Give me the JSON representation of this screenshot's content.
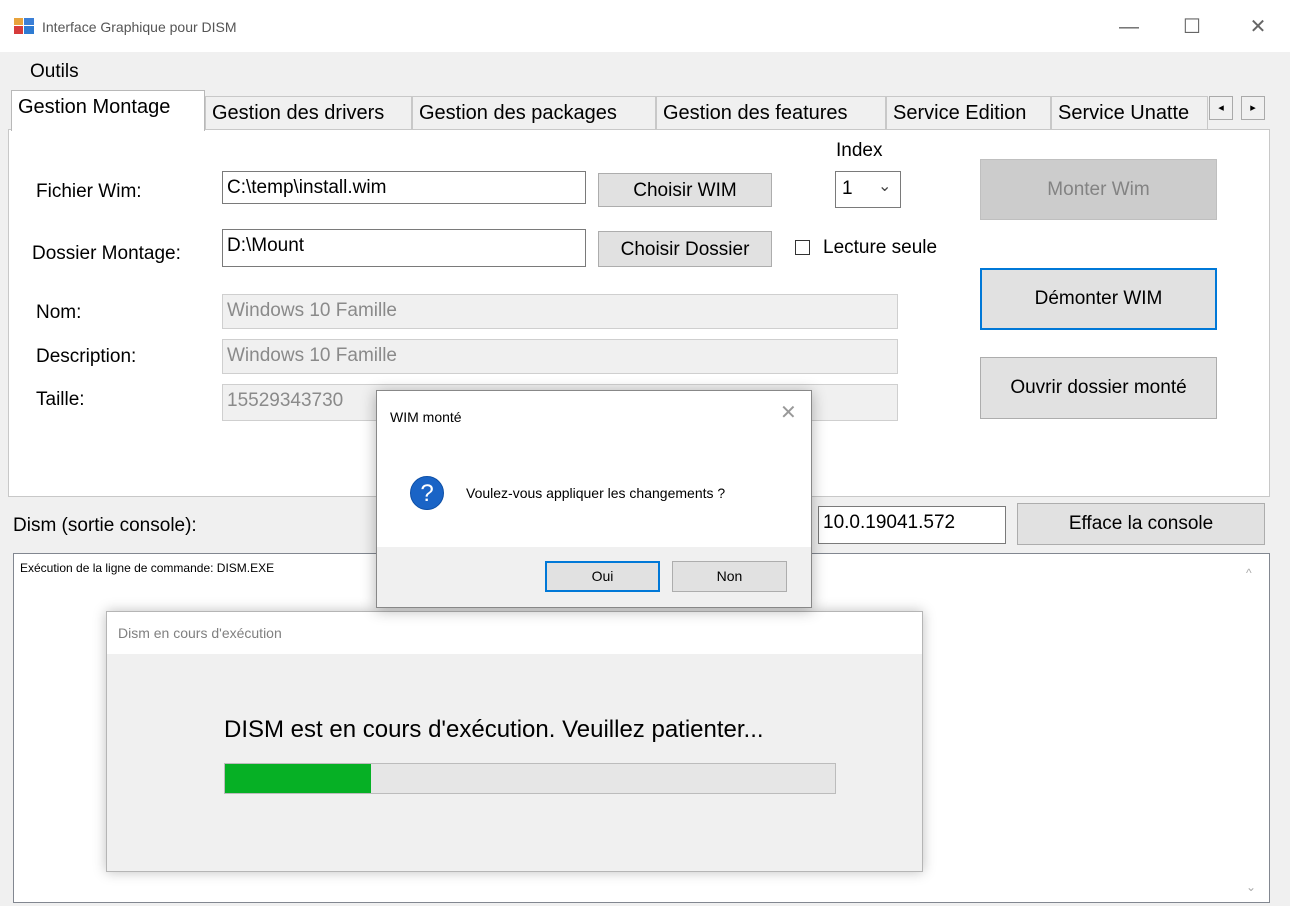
{
  "window": {
    "title": "Interface Graphique pour DISM",
    "minimize": "—",
    "maximize": "☐",
    "close": "✕"
  },
  "menu": {
    "outils": "Outils"
  },
  "tabs": [
    {
      "label": "Gestion Montage"
    },
    {
      "label": "Gestion des drivers"
    },
    {
      "label": "Gestion des packages"
    },
    {
      "label": "Gestion des features"
    },
    {
      "label": "Service Edition"
    },
    {
      "label": "Service Unatte"
    }
  ],
  "tab_scroll": {
    "left": "◂",
    "right": "▸"
  },
  "mount": {
    "fichier_label": "Fichier Wim:",
    "fichier_value": "C:\\temp\\install.wim",
    "choisir_wim": "Choisir WIM",
    "index_label": "Index",
    "index_value": "1",
    "index_chevron": "⌄",
    "monter_wim": "Monter Wim",
    "dossier_label": "Dossier Montage:",
    "dossier_value": "D:\\Mount",
    "choisir_dossier": "Choisir Dossier",
    "lecture_seule": "Lecture seule",
    "lecture_seule_checked": false,
    "demonter_wim": "Démonter WIM",
    "ouvrir_dossier": "Ouvrir dossier monté",
    "nom_label": "Nom:",
    "nom_value": "Windows 10 Famille",
    "description_label": "Description:",
    "description_value": "Windows 10 Famille",
    "taille_label": "Taille:",
    "taille_value": "15529343730"
  },
  "console": {
    "label": "Dism (sortie console):",
    "version": "10.0.19041.572",
    "clear_button": "Efface la console",
    "output": "Exécution de la ligne de commande: DISM.EXE"
  },
  "progress": {
    "title": "Dism en cours d'exécution",
    "message": "DISM est en cours d'exécution. Veuillez patienter...",
    "fraction": 0.24,
    "color": "#06b025"
  },
  "messagebox": {
    "title": "WIM monté",
    "close": "✕",
    "icon": "question-icon",
    "icon_glyph": "?",
    "text": "Voulez-vous appliquer les changements ?",
    "oui": "Oui",
    "non": "Non"
  }
}
